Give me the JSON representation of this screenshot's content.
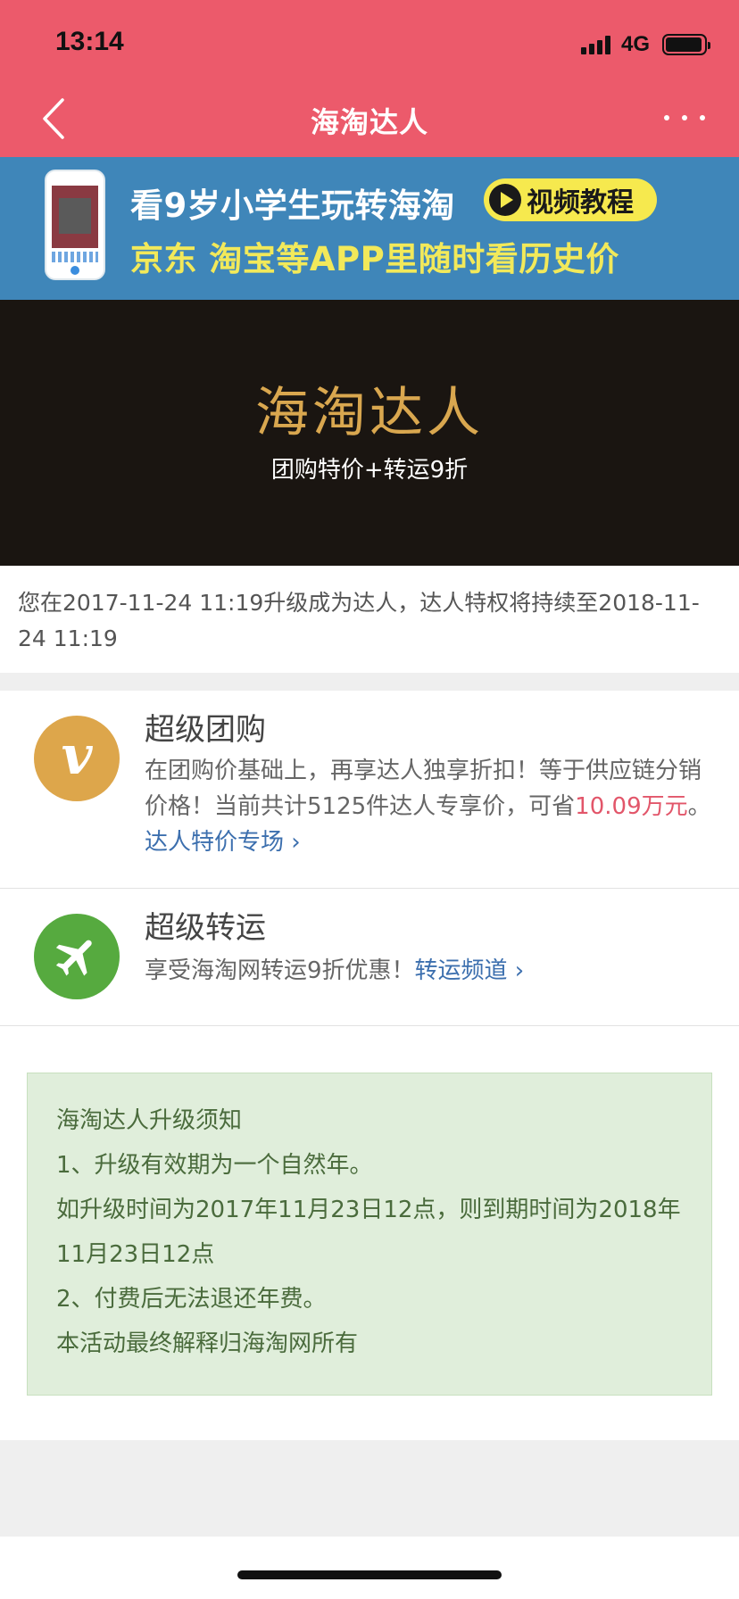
{
  "status_bar": {
    "time": "13:14",
    "network": "4G"
  },
  "nav": {
    "title": "海淘达人",
    "back_icon": "chevron-left-icon",
    "more_icon": "more-dots-icon"
  },
  "promo": {
    "line1": "看9岁小学生玩转海淘",
    "video_label": "视频教程",
    "line2": "京东 淘宝等APP里随时看历史价"
  },
  "hero": {
    "title": "海淘达人",
    "subtitle": "团购特价+转运9折"
  },
  "upgrade_info": {
    "text": "您在2017-11-24 11:19升级成为达人，达人特权将持续至2018-11-24 11:19"
  },
  "privileges": {
    "group_buy": {
      "title": "超级团购",
      "desc_prefix": "在团购价基础上，再享达人独享折扣！等于供应链分销价格！当前共计5125件达人专享价，可省",
      "savings": "10.09万元",
      "desc_mid": "。",
      "link": "达人特价专场 ›",
      "icon_glyph": "v"
    },
    "shipping": {
      "title": "超级转运",
      "desc": "享受海淘网转运9折优惠！",
      "link": "转运频道 ›"
    }
  },
  "notice": {
    "lines": [
      "海淘达人升级须知",
      "1、升级有效期为一个自然年。",
      "如升级时间为2017年11月23日12点，则到期时间为2018年11月23日12点",
      "2、付费后无法退还年费。",
      "本活动最终解释归海淘网所有"
    ]
  },
  "colors": {
    "header": "#ec5a6b",
    "promo_bg": "#3f86b9",
    "hero_bg": "#1a1511",
    "hero_title": "#d9a74f",
    "group_icon": "#dda64b",
    "ship_icon": "#56aa3f",
    "notice_bg": "#e0eedb",
    "link": "#3c6fae",
    "savings": "#e2566a"
  }
}
